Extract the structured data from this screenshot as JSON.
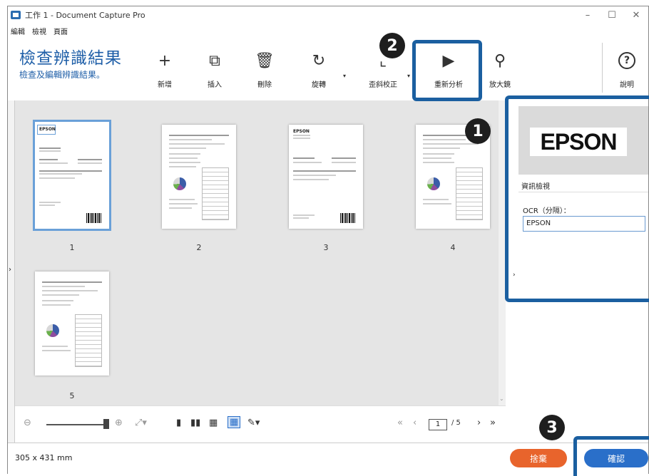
{
  "window": {
    "title": "工作 1 - Document Capture Pro",
    "controls": {
      "minimize": "–",
      "maximize": "☐",
      "close": "✕"
    }
  },
  "menu": [
    "編輯",
    "檢視",
    "頁面"
  ],
  "header": {
    "title": "檢查辨識結果",
    "subtitle": "檢查及編輯辨識結果。"
  },
  "toolbar": {
    "items": [
      {
        "label": "新增",
        "icon": "plus-icon",
        "glyph": "+"
      },
      {
        "label": "插入",
        "icon": "insert-icon",
        "glyph": "⧉"
      },
      {
        "label": "刪除",
        "icon": "trash-icon",
        "glyph": "🗑"
      },
      {
        "label": "旋轉",
        "icon": "rotate-icon",
        "glyph": "↻"
      },
      {
        "label": "歪斜校正",
        "icon": "deskew-icon",
        "glyph": "⌞"
      },
      {
        "label": "重新分析",
        "icon": "play-icon",
        "glyph": "▶"
      },
      {
        "label": "放大鏡",
        "icon": "magnifier-icon",
        "glyph": "⚲"
      },
      {
        "label": "說明",
        "icon": "help-icon",
        "glyph": "?"
      }
    ]
  },
  "pages": [
    {
      "number": "1",
      "selected": true
    },
    {
      "number": "2",
      "selected": false
    },
    {
      "number": "3",
      "selected": false
    },
    {
      "number": "4",
      "selected": false
    },
    {
      "number": "5",
      "selected": false
    }
  ],
  "pager": {
    "current": "1",
    "total": "/ 5"
  },
  "side_panel": {
    "preview_text": "EPSON",
    "section_title": "資訊檢視",
    "ocr_label": "OCR（分隔）：",
    "ocr_value": "EPSON"
  },
  "status": {
    "size": "305 x 431 mm"
  },
  "buttons": {
    "discard": "捨棄",
    "confirm": "確認"
  },
  "callouts": [
    "1",
    "2",
    "3"
  ],
  "colors": {
    "accent": "#1f5fa8",
    "discard": "#e8642c",
    "confirm": "#2a6fc9",
    "highlight": "#1b5fa0"
  }
}
